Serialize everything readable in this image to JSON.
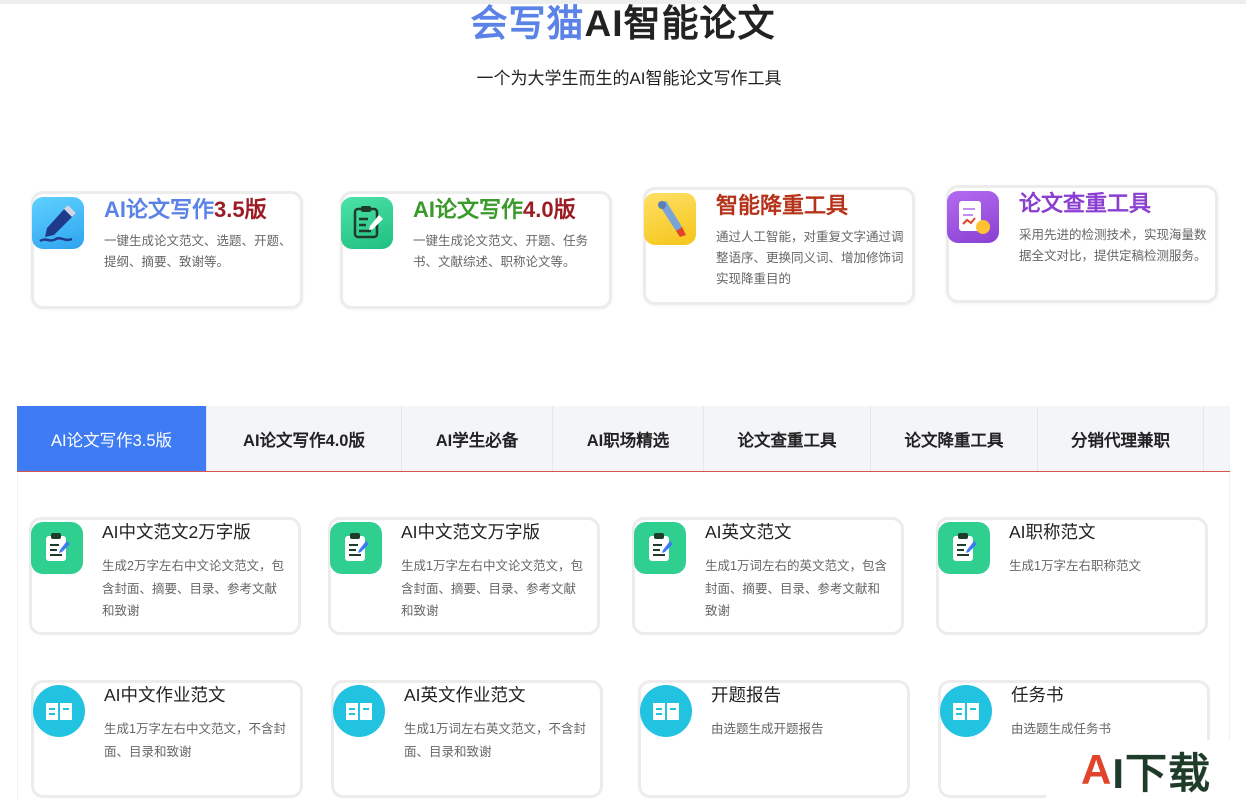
{
  "header": {
    "brand": "会写猫",
    "title_rest": "AI智能论文",
    "subtitle": "一个为大学生而生的AI智能论文写作工具"
  },
  "features": [
    {
      "title_main": "AI论文写作",
      "title_version": "3.5版",
      "desc": "一键生成论文范文、选题、开题、提纲、摘要、致谢等。",
      "icon": "pen-writing-icon",
      "color_main": "#5b82e6",
      "color_version": "#9b1c24"
    },
    {
      "title_main": "AI论文写作",
      "title_version": "4.0版",
      "desc": "一键生成论文范文、开题、任务书、文献综述、职称论文等。",
      "icon": "clipboard-pen-icon",
      "color_main": "#3a9a2a",
      "color_version": "#9b1c24"
    },
    {
      "title_main": "智能降重工具",
      "title_version": "",
      "desc": "通过人工智能，对重复文字通过调整语序、更换同义词、增加修饰词实现降重目的",
      "icon": "correction-pen-icon",
      "color_main": "#b5331a",
      "color_version": "#b5331a"
    },
    {
      "title_main": "论文查重工具",
      "title_version": "",
      "desc": "采用先进的检测技术，实现海量数据全文对比，提供定稿检测服务。",
      "icon": "report-check-icon",
      "color_main": "#8a3fd1",
      "color_version": "#8a3fd1"
    }
  ],
  "tabs": [
    {
      "label": "AI论文写作3.5版",
      "active": true
    },
    {
      "label": "AI论文写作4.0版",
      "active": false
    },
    {
      "label": "AI学生必备",
      "active": false
    },
    {
      "label": "AI职场精选",
      "active": false
    },
    {
      "label": "论文查重工具",
      "active": false
    },
    {
      "label": "论文降重工具",
      "active": false
    },
    {
      "label": "分销代理兼职",
      "active": false
    }
  ],
  "tools": [
    {
      "title": "AI中文范文2万字版",
      "desc": "生成2万字左右中文论文范文，包含封面、摘要、目录、参考文献和致谢",
      "icon": "clipboard-pen-icon"
    },
    {
      "title": "AI中文范文万字版",
      "desc": "生成1万字左右中文论文范文，包含封面、摘要、目录、参考文献和致谢",
      "icon": "clipboard-pen-icon"
    },
    {
      "title": "AI英文范文",
      "desc": "生成1万词左右的英文范文，包含封面、摘要、目录、参考文献和致谢",
      "icon": "clipboard-pen-icon"
    },
    {
      "title": "AI职称范文",
      "desc": "生成1万字左右职称范文",
      "icon": "clipboard-pen-icon"
    },
    {
      "title": "AI中文作业范文",
      "desc": "生成1万字左右中文范文，不含封面、目录和致谢",
      "icon": "open-book-icon"
    },
    {
      "title": "AI英文作业范文",
      "desc": "生成1万词左右英文范文，不含封面、目录和致谢",
      "icon": "open-book-icon"
    },
    {
      "title": "开题报告",
      "desc": "由选题生成开题报告",
      "icon": "open-book-icon"
    },
    {
      "title": "任务书",
      "desc": "由选题生成任务书",
      "icon": "open-book-icon"
    }
  ],
  "watermark": {
    "a": "A",
    "rest": "I下载"
  },
  "colors": {
    "tab_active": "#3f7cf4",
    "green_icon": "#2ecf8f",
    "cyan_icon": "#22c3e0",
    "accent_red": "#d9534f"
  }
}
